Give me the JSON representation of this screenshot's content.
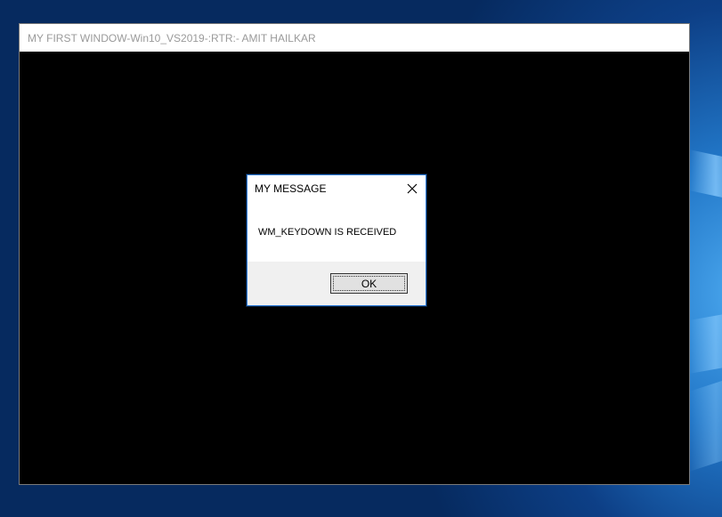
{
  "window": {
    "title": "MY FIRST WINDOW-Win10_VS2019-:RTR:- AMIT HAILKAR",
    "client_background": "#000000"
  },
  "message_box": {
    "title": "MY MESSAGE",
    "close_icon": "close-icon",
    "text": "WM_KEYDOWN IS RECEIVED",
    "ok_label": "OK",
    "accent_border": "#2b79d6"
  }
}
